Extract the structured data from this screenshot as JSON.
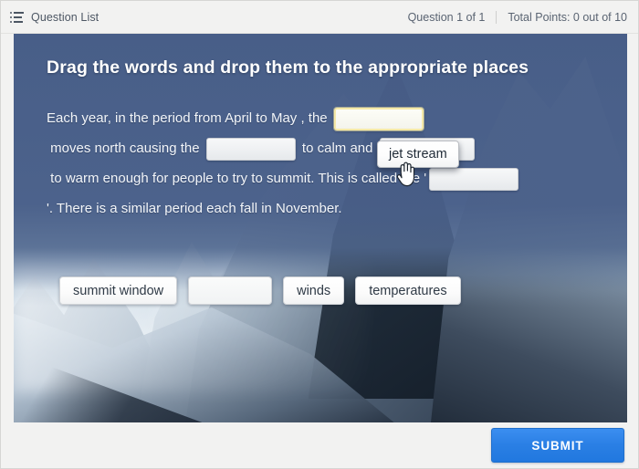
{
  "topbar": {
    "question_list_label": "Question List",
    "question_counter": "Question 1 of 1",
    "total_points": "Total Points: 0 out of 10",
    "list_icon": "list-icon"
  },
  "question": {
    "title": "Drag the words and drop them to the appropriate places",
    "text_segments": [
      "Each year, in the period from April to May , the ",
      " moves north causing the ",
      " to calm and ",
      " to warm enough for people to try to summit. This is called the '",
      "'. There is a similar period each fall in November."
    ],
    "blanks": [
      {
        "id": "blank-1",
        "value": "",
        "state": "active"
      },
      {
        "id": "blank-2",
        "value": "",
        "state": "empty"
      },
      {
        "id": "blank-3",
        "value": "",
        "state": "empty"
      },
      {
        "id": "blank-4",
        "value": "",
        "state": "empty"
      }
    ]
  },
  "word_bank": [
    {
      "label": "summit window",
      "state": "available"
    },
    {
      "label": "",
      "state": "dragging-source"
    },
    {
      "label": "winds",
      "state": "available"
    },
    {
      "label": "temperatures",
      "state": "available"
    }
  ],
  "drag": {
    "chip_label": "jet stream",
    "cursor": "grab-hand-cursor"
  },
  "footer": {
    "submit_label": "SUBMIT"
  },
  "colors": {
    "accent_blue": "#2a7fe4",
    "overlay_blue": "#4a5d87",
    "page_bg": "#f2f2f1",
    "highlight_yellow": "#f5e9a8",
    "text_light": "#f2f5f9",
    "text_dark": "#4c5663"
  }
}
